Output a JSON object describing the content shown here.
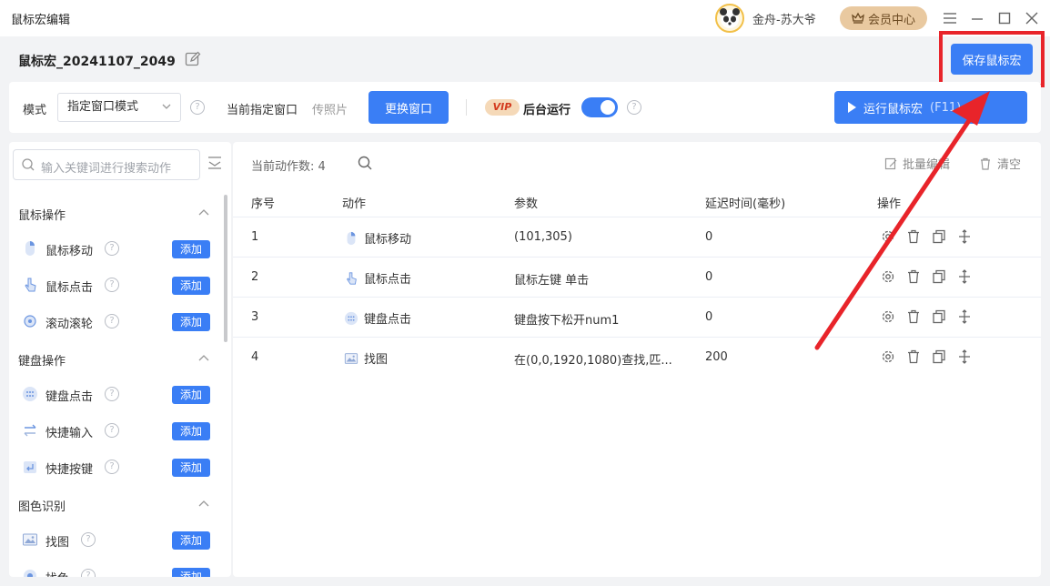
{
  "titlebar": {
    "title": "鼠标宏编辑",
    "username": "金舟-苏大爷",
    "vip_center": "会员中心"
  },
  "header": {
    "macro_name": "鼠标宏_20241107_2049",
    "save_label": "保存鼠标宏"
  },
  "toolbar": {
    "mode_label": "模式",
    "mode_value": "指定窗口模式",
    "current_window_label": "当前指定窗口",
    "current_window_value": "传照片",
    "change_window": "更换窗口",
    "vip_badge": "VIP",
    "background_run": "后台运行",
    "run_label": "运行鼠标宏",
    "run_hotkey": "(F11)"
  },
  "sidebar": {
    "search_placeholder": "输入关键词进行搜索动作",
    "add_label": "添加",
    "groups": [
      {
        "title": "鼠标操作",
        "items": [
          {
            "label": "鼠标移动"
          },
          {
            "label": "鼠标点击"
          },
          {
            "label": "滚动滚轮"
          }
        ]
      },
      {
        "title": "键盘操作",
        "items": [
          {
            "label": "键盘点击"
          },
          {
            "label": "快捷输入"
          },
          {
            "label": "快捷按键"
          }
        ]
      },
      {
        "title": "图色识别",
        "items": [
          {
            "label": "找图"
          },
          {
            "label": "找色"
          }
        ]
      }
    ]
  },
  "main": {
    "count_label": "当前动作数:",
    "count_value": "4",
    "batch_edit": "批量编辑",
    "clear": "清空",
    "headers": [
      "序号",
      "动作",
      "参数",
      "延迟时间(毫秒)",
      "操作"
    ],
    "rows": [
      {
        "index": "1",
        "action": "鼠标移动",
        "param": "(101,305)",
        "delay": "0"
      },
      {
        "index": "2",
        "action": "鼠标点击",
        "param": "鼠标左键 单击",
        "delay": "0"
      },
      {
        "index": "3",
        "action": "键盘点击",
        "param": "键盘按下松开num1",
        "delay": "0"
      },
      {
        "index": "4",
        "action": "找图",
        "param": "在(0,0,1920,1080)查找,匹...",
        "delay": "200"
      }
    ]
  },
  "colors": {
    "accent": "#3a7ef5",
    "highlight": "#e8242a"
  }
}
